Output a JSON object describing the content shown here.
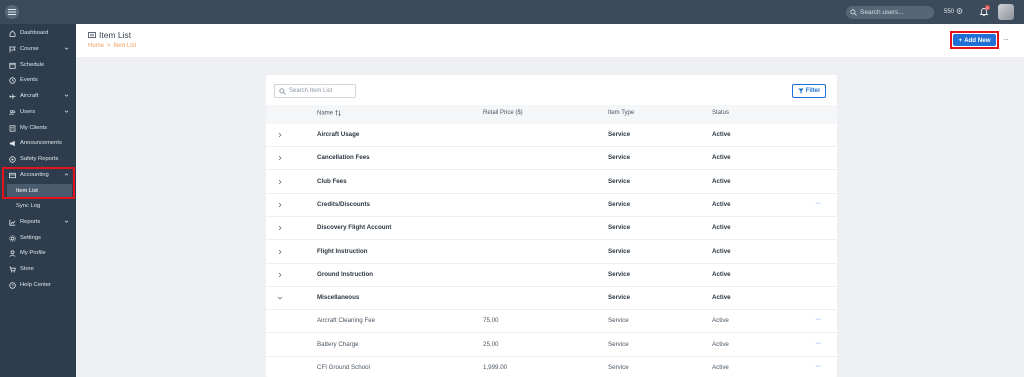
{
  "topbar": {
    "search_placeholder": "Search users...",
    "credits": "550",
    "notification_count": "4"
  },
  "sidebar": {
    "items": [
      {
        "label": "Dashboard",
        "icon": "home-icon"
      },
      {
        "label": "Course",
        "icon": "flag-icon",
        "expandable": true
      },
      {
        "label": "Schedule",
        "icon": "calendar-icon"
      },
      {
        "label": "Events",
        "icon": "clock-icon"
      },
      {
        "label": "Aircraft",
        "icon": "plane-icon",
        "expandable": true
      },
      {
        "label": "Users",
        "icon": "users-icon",
        "expandable": true
      },
      {
        "label": "My Clients",
        "icon": "clients-icon"
      },
      {
        "label": "Announcements",
        "icon": "megaphone-icon"
      },
      {
        "label": "Safety Reports",
        "icon": "shield-icon"
      },
      {
        "label": "Accounting",
        "icon": "accounting-icon",
        "expanded": true
      },
      {
        "label": "Item List",
        "sub": true,
        "active": true
      },
      {
        "label": "Sync Log",
        "sub": true
      },
      {
        "label": "Reports",
        "icon": "chart-icon",
        "expandable": true
      },
      {
        "label": "Settings",
        "icon": "gear-icon"
      },
      {
        "label": "My Profile",
        "icon": "user-icon"
      },
      {
        "label": "Store",
        "icon": "cart-icon"
      },
      {
        "label": "Help Center",
        "icon": "help-icon"
      }
    ]
  },
  "header": {
    "title": "Item List",
    "breadcrumb_home": "Home",
    "breadcrumb_sep": ">",
    "breadcrumb_current": "Item List",
    "add_button": "Add New",
    "add_plus": "+",
    "more": "···"
  },
  "table": {
    "search_placeholder": "Search Item List",
    "filter_label": "Filter",
    "columns": [
      "Name",
      "Retail Price ($)",
      "Item Type",
      "Status"
    ],
    "rows": [
      {
        "name": "Aircraft Usage",
        "price": "",
        "type": "Service",
        "status": "Active",
        "group": true,
        "expanded": false,
        "more": false
      },
      {
        "name": "Cancellation Fees",
        "price": "",
        "type": "Service",
        "status": "Active",
        "group": true,
        "expanded": false,
        "more": false
      },
      {
        "name": "Club Fees",
        "price": "",
        "type": "Service",
        "status": "Active",
        "group": true,
        "expanded": false,
        "more": false
      },
      {
        "name": "Credits/Discounts",
        "price": "",
        "type": "Service",
        "status": "Active",
        "group": true,
        "expanded": false,
        "more": true
      },
      {
        "name": "Discovery Flight Account",
        "price": "",
        "type": "Service",
        "status": "Active",
        "group": true,
        "expanded": false,
        "more": false
      },
      {
        "name": "Flight Instruction",
        "price": "",
        "type": "Service",
        "status": "Active",
        "group": true,
        "expanded": false,
        "more": false
      },
      {
        "name": "Ground Instruction",
        "price": "",
        "type": "Service",
        "status": "Active",
        "group": true,
        "expanded": false,
        "more": false
      },
      {
        "name": "Miscellaneous",
        "price": "",
        "type": "Service",
        "status": "Active",
        "group": true,
        "expanded": true,
        "more": false
      },
      {
        "name": "Aircraft Cleaning Fee",
        "price": "75.00",
        "type": "Service",
        "status": "Active",
        "group": false,
        "more": true
      },
      {
        "name": "Battery Charge",
        "price": "25.00",
        "type": "Service",
        "status": "Active",
        "group": false,
        "more": true
      },
      {
        "name": "CFI Ground School",
        "price": "1,999.00",
        "type": "Service",
        "status": "Active",
        "group": false,
        "more": true
      }
    ],
    "row_more": "···"
  },
  "colors": {
    "accent": "#1f6fd6",
    "sidebar_bg": "#2d3d4e",
    "topbar_bg": "#3c4b5b",
    "highlight": "#e3141d"
  }
}
